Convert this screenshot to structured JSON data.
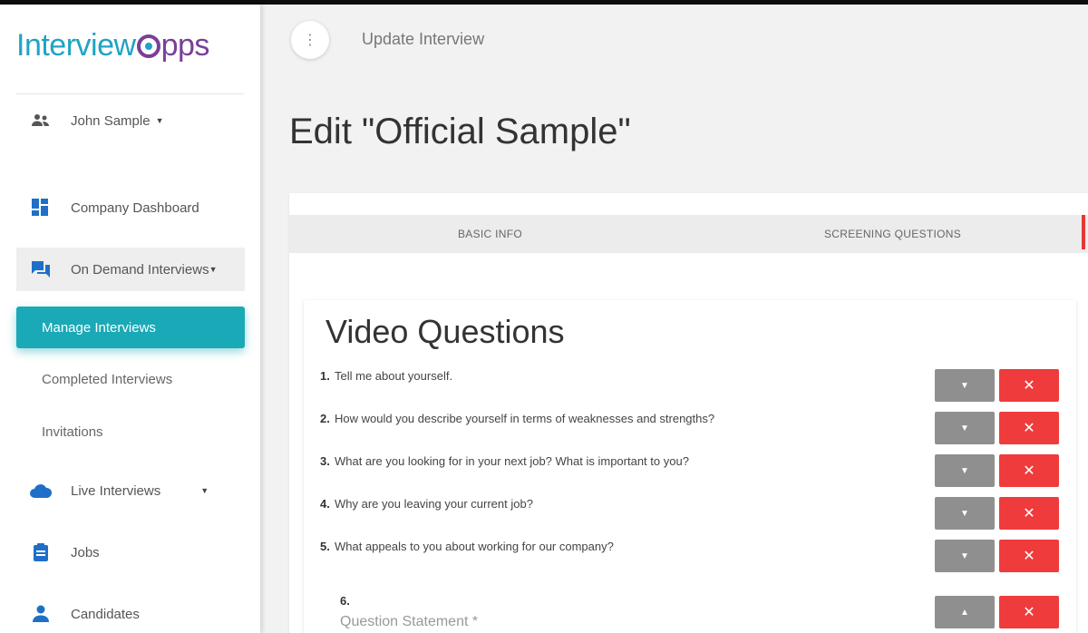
{
  "logo": {
    "part1": "Interview",
    "part2": "pps"
  },
  "user": {
    "name": "John Sample"
  },
  "sidebar": {
    "company_dashboard": "Company Dashboard",
    "on_demand": "On Demand Interviews",
    "manage": "Manage Interviews",
    "completed": "Completed Interviews",
    "invitations": "Invitations",
    "live": "Live Interviews",
    "jobs": "Jobs",
    "candidates": "Candidates"
  },
  "topbar": {
    "title": "Update Interview"
  },
  "page": {
    "title": "Edit \"Official Sample\""
  },
  "tabs": {
    "basic": "BASIC INFO",
    "screening": "SCREENING QUESTIONS"
  },
  "video": {
    "title": "Video Questions",
    "questions": [
      {
        "num": "1.",
        "text": "Tell me about yourself."
      },
      {
        "num": "2.",
        "text": "How would you describe yourself in terms of weaknesses and strengths?"
      },
      {
        "num": "3.",
        "text": "What are you looking for in your next job? What is important to you?"
      },
      {
        "num": "4.",
        "text": "Why are you leaving your current job?"
      },
      {
        "num": "5.",
        "text": "What appeals to you about working for our company?"
      }
    ],
    "new_question": {
      "num": "6.",
      "label": "Question Statement *"
    }
  },
  "colors": {
    "brand_blue": "#1fa3c5",
    "brand_purple": "#7a3f98",
    "active_teal": "#1aa9b6",
    "delete_red": "#ef3b3b",
    "move_grey": "#8f8f8f"
  }
}
